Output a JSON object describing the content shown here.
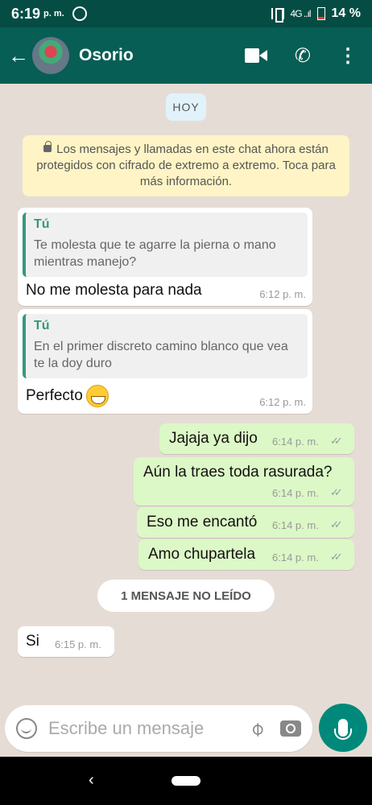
{
  "status_bar": {
    "time": "6:19",
    "ampm": "p. m.",
    "signal": "4G ..ıl",
    "battery": "14 %"
  },
  "header": {
    "back_icon": "arrow-left-icon",
    "contact_name": "Osorio"
  },
  "chat": {
    "day_label": "HOY",
    "encryption_notice": "Los mensajes y llamadas en este chat ahora están protegidos con cifrado de extremo a extremo. Toca para más información.",
    "messages": [
      {
        "direction": "in",
        "quote_author": "Tú",
        "quote_text": "Te molesta que te agarre la pierna o mano mientras manejo?",
        "text": "No me molesta para  nada",
        "time": "6:12 p. m."
      },
      {
        "direction": "in",
        "quote_author": "Tú",
        "quote_text": "En el primer discreto camino blanco que vea te la doy duro",
        "text": "Perfecto",
        "emoji": "grinning-face-icon",
        "time": "6:12 p. m."
      },
      {
        "direction": "out",
        "text": "Jajaja ya dijo",
        "time": "6:14 p. m.",
        "status": "read"
      },
      {
        "direction": "out",
        "text": "Aún la traes toda rasurada?",
        "time": "6:14 p. m.",
        "status": "read"
      },
      {
        "direction": "out",
        "text": "Eso me encantó",
        "time": "6:14 p. m.",
        "status": "read"
      },
      {
        "direction": "out",
        "text": "Amo chupartela",
        "time": "6:14 p. m.",
        "status": "read"
      },
      {
        "direction": "in",
        "text": "Si",
        "time": "6:15 p. m."
      }
    ],
    "unread_label": "1 MENSAJE NO LEÍDO"
  },
  "composer": {
    "placeholder": "Escribe un mensaje"
  },
  "colors": {
    "header": "#075e54",
    "status_bar": "#054d44",
    "outgoing": "#dcf8c6",
    "accent": "#00897b"
  },
  "ticks": "✓✓"
}
